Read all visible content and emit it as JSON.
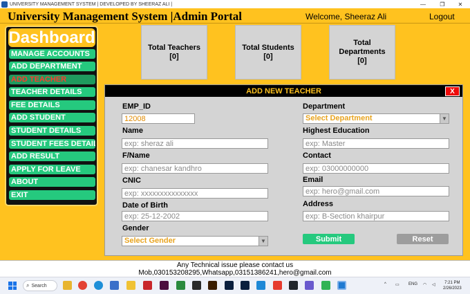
{
  "window": {
    "title": "UNIVERSITY MANAGEMENT SYSTEM | DEVELOPED BY SHEERAZ ALI |",
    "controls": {
      "minimize": "—",
      "maximize": "❐",
      "close": "✕"
    }
  },
  "header": {
    "title": "University Management System |Admin Portal",
    "welcome": "Welcome, Sheeraz Ali",
    "logout": "Logout"
  },
  "sidebar": {
    "dashboard": "Dashboard",
    "items": [
      {
        "label": "MANAGE ACCOUNTS"
      },
      {
        "label": "ADD DEPARTMENT"
      },
      {
        "label": "ADD TEACHER",
        "active": true
      },
      {
        "label": "TEACHER DETAILS"
      },
      {
        "label": "FEE DETAILS"
      },
      {
        "label": "ADD STUDENT"
      },
      {
        "label": "STUDENT DETAILS"
      },
      {
        "label": "STUDENT FEES DETAIL"
      },
      {
        "label": "ADD RESULT"
      },
      {
        "label": "APPLY FOR LEAVE"
      },
      {
        "label": "ABOUT"
      },
      {
        "label": "EXIT"
      }
    ]
  },
  "stats": [
    {
      "label": "Total Teachers",
      "value": "[0]"
    },
    {
      "label": "Total Students",
      "value": "[0]"
    },
    {
      "label": "Total Departments",
      "value": "[0]"
    }
  ],
  "form": {
    "title": "ADD NEW TEACHER",
    "close": "X",
    "emp_id": {
      "label": "EMP_ID",
      "value": "12008"
    },
    "name": {
      "label": "Name",
      "placeholder": "exp: sheraz ali"
    },
    "fname": {
      "label": "F/Name",
      "placeholder": "exp: chanesar kandhro"
    },
    "cnic": {
      "label": "CNIC",
      "placeholder": "exp: xxxxxxxxxxxxxxx"
    },
    "dob": {
      "label": "Date of Birth",
      "placeholder": "exp: 25-12-2002"
    },
    "gender": {
      "label": "Gender",
      "selected": "Select Gender"
    },
    "department": {
      "label": "Department",
      "selected": "Select Department"
    },
    "education": {
      "label": "Highest Education",
      "placeholder": "exp: Master"
    },
    "contact": {
      "label": "Contact",
      "placeholder": "exp: 03000000000"
    },
    "email": {
      "label": "Email",
      "placeholder": "exp: hero@gmail.com"
    },
    "address": {
      "label": "Address",
      "placeholder": "exp: B-Section khairpur"
    },
    "submit": "Submit",
    "reset": "Reset"
  },
  "footer": {
    "line1": "Any Technical issue please contact us",
    "line2": "Mob,030153208295,Whatsapp,03151386241,hero@gmail.com"
  },
  "taskbar": {
    "search": "Search",
    "lang": "ENG",
    "time": "7:21 PM",
    "date": "2/26/2023"
  },
  "colors": {
    "background": "#ffc21f",
    "nav": "#25c97e",
    "panel": "#d4d4d4",
    "close": "#ef0a0a"
  }
}
